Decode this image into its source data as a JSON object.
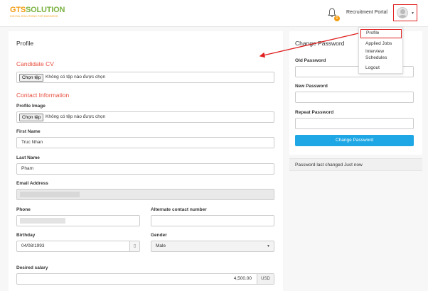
{
  "header": {
    "logo_main_gts": "GTS",
    "logo_main_rest": "SOLUTION",
    "logo_sub": "DIGITAL SOLUTIONS FOR BUSINESS",
    "notification_count": "0",
    "portal_label": "Recruitment Portal"
  },
  "dropdown": {
    "items": [
      "Profile",
      "Applied Jobs",
      "Interview",
      "Schedules",
      "Logout"
    ]
  },
  "profile": {
    "title": "Profile",
    "candidate_cv_heading": "Candidate CV",
    "file_button": "Chọn tệp",
    "no_file_text": "Không có tệp nào được chọn",
    "contact_heading": "Contact Information",
    "profile_image_label": "Profile Image",
    "first_name_label": "First Name",
    "first_name_value": "Truc Nhan",
    "last_name_label": "Last Name",
    "last_name_value": "Pham",
    "email_label": "Email Address",
    "phone_label": "Phone",
    "alt_contact_label": "Alternate contact number",
    "birthday_label": "Birthday",
    "birthday_value": "04/08/1993",
    "gender_label": "Gender",
    "gender_value": "Male",
    "salary_label": "Desired salary",
    "salary_value": "4,500.00",
    "currency": "USD"
  },
  "change_password": {
    "title": "Change Password",
    "old_label": "Old Password",
    "new_label": "New Password",
    "repeat_label": "Repeat Password",
    "button": "Change Password",
    "status": "Password last changed Just now"
  },
  "colors": {
    "accent": "#1ea7e4",
    "section_heading": "#e74c3c",
    "highlight": "#e02020",
    "logo_orange": "#f39c12",
    "logo_green": "#7cb342"
  }
}
